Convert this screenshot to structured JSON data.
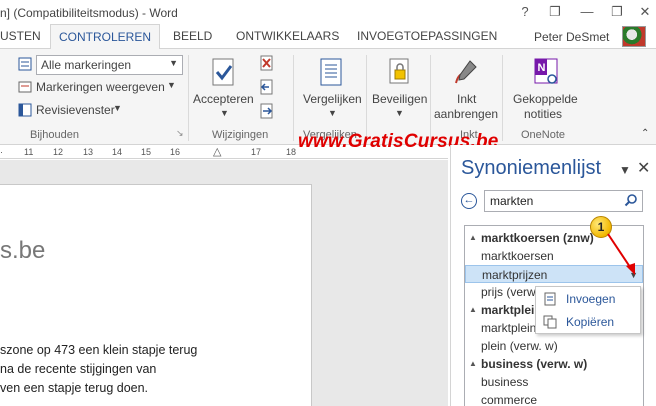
{
  "window": {
    "title": "n] (Compatibiliteitsmodus) - Word",
    "help": "?",
    "minimize": "—",
    "restore": "❐",
    "close": "✕"
  },
  "tabs": [
    {
      "label": "USTEN"
    },
    {
      "label": "CONTROLEREN"
    },
    {
      "label": "BEELD"
    },
    {
      "label": "ONTWIKKELAARS"
    },
    {
      "label": "INVOEGTOEPASSINGEN"
    }
  ],
  "user": {
    "name": "Peter DeSmet"
  },
  "ribbon": {
    "markup_dropdown": "Alle markeringen",
    "show_markup": "Markeringen weergeven",
    "reviewing_pane": "Revisievenster",
    "group_tracking": "Bijhouden",
    "accept": "Accepteren",
    "group_changes": "Wijzigingen",
    "compare": "Vergelijken",
    "group_compare": "Vergelijken",
    "protect": "Beveiligen",
    "ink_line1": "Inkt",
    "ink_line2": "aanbrengen",
    "group_ink": "Inkt",
    "linked_line1": "Gekoppelde",
    "linked_line2": "notities",
    "group_onenote": "OneNote"
  },
  "ruler": {
    "ticks": [
      "11",
      "12",
      "13",
      "14",
      "15",
      "16",
      "17",
      "18"
    ]
  },
  "document": {
    "heading": "s.be",
    "lines": [
      "szone op 473 een klein stapje terug",
      "na de recente stijgingen van",
      "ven een stapje terug doen."
    ]
  },
  "watermark": "www.GratisCursus.be",
  "thesaurus": {
    "title": "Synoniemenlijst",
    "options_icon": "▼",
    "close_icon": "✕",
    "search_value": "markten",
    "results": [
      {
        "text": "marktkoersen (znw)",
        "type": "head"
      },
      {
        "text": "marktkoersen",
        "type": "item"
      },
      {
        "text": "marktprijzen",
        "type": "selected"
      },
      {
        "text": "prijs (verw. w)",
        "type": "item"
      },
      {
        "text": "marktplein",
        "type": "head"
      },
      {
        "text": "marktplein",
        "type": "item"
      },
      {
        "text": "plein (verw. w)",
        "type": "item"
      },
      {
        "text": "business (verw. w)",
        "type": "head"
      },
      {
        "text": "business",
        "type": "item"
      },
      {
        "text": "commerce",
        "type": "item"
      }
    ]
  },
  "context_menu": {
    "insert": "Invoegen",
    "copy": "Kopiëren"
  },
  "callout": {
    "number": "1"
  },
  "colors": {
    "accent": "#2b579a",
    "watermark": "#e00000",
    "badge": "#f2b800",
    "selection": "#cde3f7"
  }
}
